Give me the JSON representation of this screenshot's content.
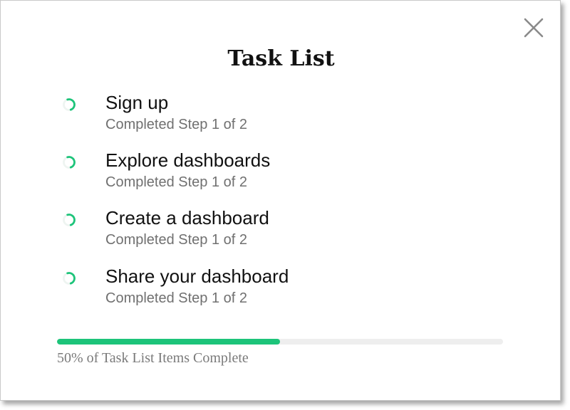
{
  "modal": {
    "title": "Task List",
    "close_icon": "close-icon"
  },
  "tasks": [
    {
      "name": "Sign up",
      "status": "Completed Step 1 of 2",
      "icon": "partial-progress-ring-icon"
    },
    {
      "name": "Explore dashboards",
      "status": "Completed Step 1 of 2",
      "icon": "partial-progress-ring-icon"
    },
    {
      "name": "Create a dashboard",
      "status": "Completed Step 1 of 2",
      "icon": "partial-progress-ring-icon"
    },
    {
      "name": "Share your dashboard",
      "status": "Completed Step 1 of 2",
      "icon": "partial-progress-ring-icon"
    }
  ],
  "progress": {
    "percent": 50,
    "label": "50% of Task List Items Complete"
  },
  "colors": {
    "accent": "#1dc47a",
    "track": "#eeeeee",
    "muted_text": "#707070"
  }
}
